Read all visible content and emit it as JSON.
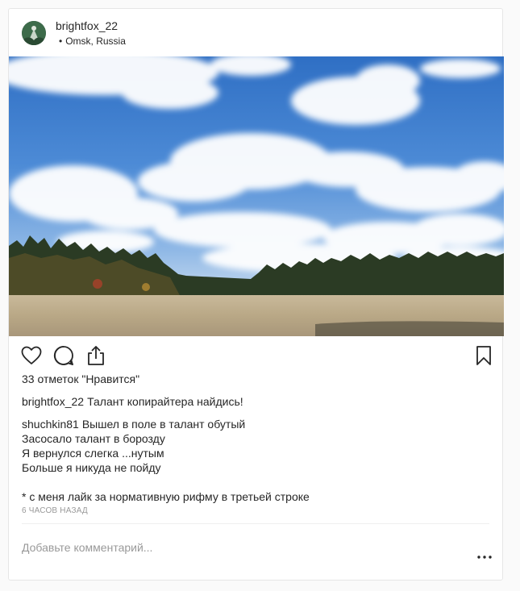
{
  "post": {
    "author": "brightfox_22",
    "location": "Omsk, Russia",
    "location_dot": "•",
    "likes": "33 отметок \"Нравится\"",
    "caption": {
      "author": "brightfox_22",
      "text": "Талант копирайтера найдись!"
    },
    "reply": {
      "author": "shuchkin81",
      "lines": [
        "Вышел в поле в талант обутый",
        "Засосало талант в борозду",
        "Я вернулся слегка ...нутым",
        "Больше я никуда не пойду"
      ],
      "footnote": "* с меня лайк за нормативную рифму в третьей строке"
    },
    "timestamp": "6 часов назад",
    "add_comment_placeholder": "Добавьте комментарий...",
    "icons": {
      "like": "heart-icon",
      "comment": "comment-icon",
      "share": "share-icon",
      "save": "bookmark-icon",
      "more": "more-options-icon"
    }
  }
}
